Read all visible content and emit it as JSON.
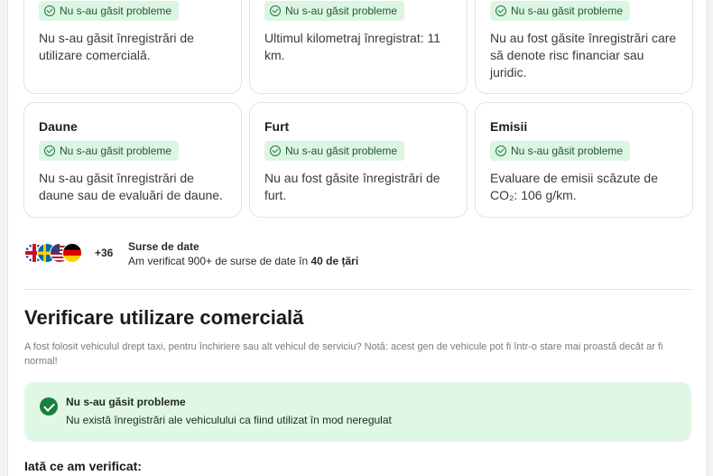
{
  "status_badge_label": "Nu s-au găsit probleme",
  "cards_top": [
    {
      "text": "Nu s-au găsit înregistrări de utilizare comercială."
    },
    {
      "text": "Ultimul kilometraj înregistrat: 11 km."
    },
    {
      "text": "Nu au fost găsite înregistrări care să denote risc financiar sau juridic."
    }
  ],
  "cards_bottom": [
    {
      "title": "Daune",
      "text": "Nu s-au găsit înregistrări de daune sau de evaluări de daune."
    },
    {
      "title": "Furt",
      "text": "Nu au fost găsite înregistrări de furt."
    },
    {
      "title": "Emisii",
      "text": "Evaluare de emisii scăzute de CO₂: 106 g/km."
    }
  ],
  "data_sources": {
    "extra_count": "+36",
    "title": "Surse de date",
    "desc_prefix": "Am verificat 900+ de surse de date în ",
    "desc_bold": "40 de țări"
  },
  "commercial_use": {
    "title": "Verificare utilizare comercială",
    "description": "A fost folosit vehiculul drept taxi, pentru închiriere sau alt vehicul de serviciu? Notă: acest gen de vehicule pot fi într-o stare mai proastă decât ar fi normal!",
    "alert_title": "Nu s-au găsit probleme",
    "alert_text": "Nu există înregistrări ale vehiculului ca fiind utilizat în mod neregulat",
    "checked_heading": "Iată ce am verificat:"
  },
  "colors": {
    "ok_green": "#1a7f3c",
    "badge_bg": "#ddf5e3",
    "alert_bg": "#e1f7e6"
  }
}
